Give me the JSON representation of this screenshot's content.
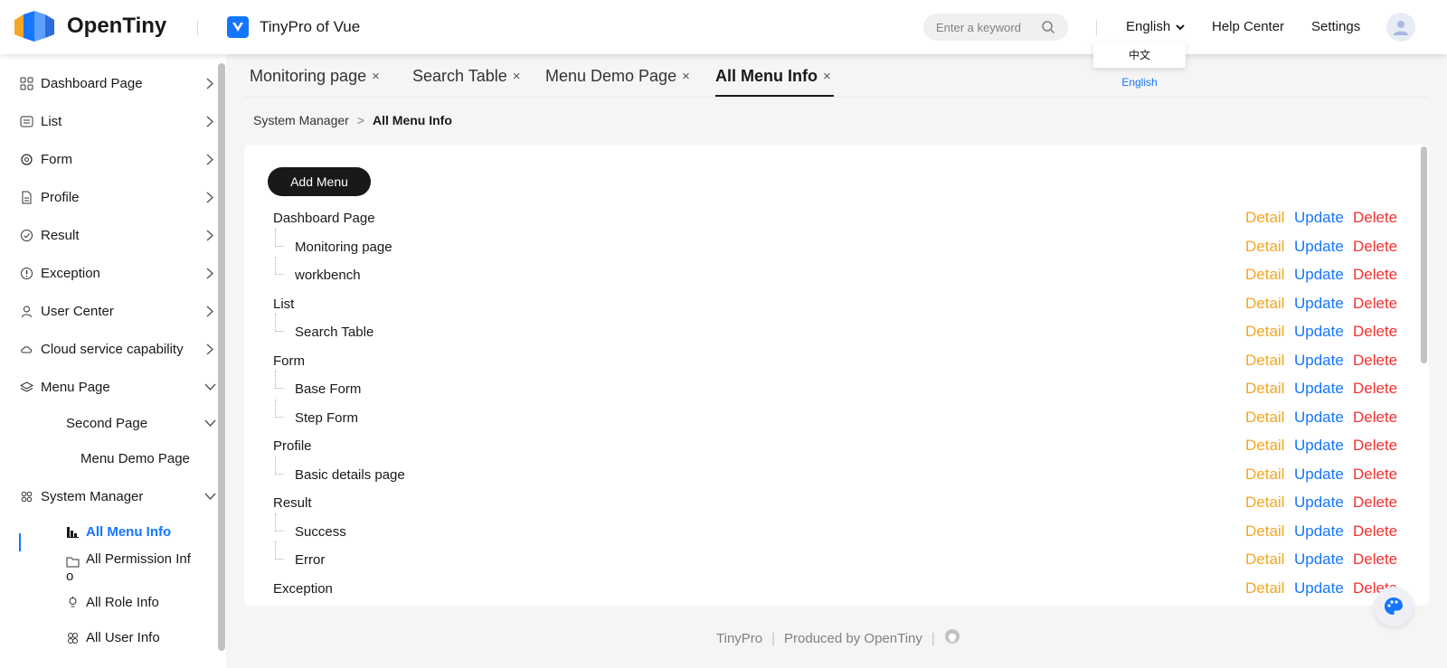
{
  "header": {
    "brand": "OpenTiny",
    "app_name": "TinyPro of Vue",
    "search_placeholder": "Enter a keyword",
    "language": "English",
    "help": "Help Center",
    "settings": "Settings",
    "lang_options": [
      "中文",
      "English"
    ]
  },
  "sidebar": {
    "items": [
      {
        "label": "Dashboard Page",
        "icon": "grid-icon"
      },
      {
        "label": "List",
        "icon": "list-icon"
      },
      {
        "label": "Form",
        "icon": "gear-icon"
      },
      {
        "label": "Profile",
        "icon": "document-icon"
      },
      {
        "label": "Result",
        "icon": "check-circle-icon"
      },
      {
        "label": "Exception",
        "icon": "alert-circle-icon"
      },
      {
        "label": "User Center",
        "icon": "user-icon"
      },
      {
        "label": "Cloud service capability",
        "icon": "cloud-icon"
      },
      {
        "label": "Menu Page",
        "icon": "layers-icon"
      },
      {
        "label": "System Manager",
        "icon": "apps-icon"
      }
    ],
    "second_page": "Second Page",
    "menu_demo_page": "Menu Demo Page",
    "system_children": [
      "All Menu Info",
      "All Permission Inf",
      "o",
      "All Role Info",
      "All User Info"
    ]
  },
  "tabs": [
    {
      "label": "Monitoring page",
      "close": "×"
    },
    {
      "label": "Search Table",
      "close": "×"
    },
    {
      "label": "Menu Demo Page",
      "close": "×"
    },
    {
      "label": "All Menu Info",
      "close": "×"
    }
  ],
  "breadcrumb": {
    "parent": "System Manager",
    "sep": ">",
    "current": "All Menu Info"
  },
  "main": {
    "add_button": "Add Menu",
    "actions": {
      "detail": "Detail",
      "update": "Update",
      "delete": "Delete"
    },
    "rows": [
      {
        "label": "Dashboard Page",
        "level": 0
      },
      {
        "label": "Monitoring page",
        "level": 1
      },
      {
        "label": "workbench",
        "level": 1
      },
      {
        "label": "List",
        "level": 0
      },
      {
        "label": "Search Table",
        "level": 1
      },
      {
        "label": "Form",
        "level": 0
      },
      {
        "label": "Base Form",
        "level": 1
      },
      {
        "label": "Step Form",
        "level": 1
      },
      {
        "label": "Profile",
        "level": 0
      },
      {
        "label": "Basic details page",
        "level": 1
      },
      {
        "label": "Result",
        "level": 0
      },
      {
        "label": "Success",
        "level": 1
      },
      {
        "label": "Error",
        "level": 1
      },
      {
        "label": "Exception",
        "level": 0
      }
    ]
  },
  "footer": {
    "name": "TinyPro",
    "sep": "|",
    "produced": "Produced by OpenTiny"
  },
  "colors": {
    "accent": "#1476ff",
    "detail": "#f5a623",
    "update": "#1476ff",
    "delete": "#f23030"
  }
}
